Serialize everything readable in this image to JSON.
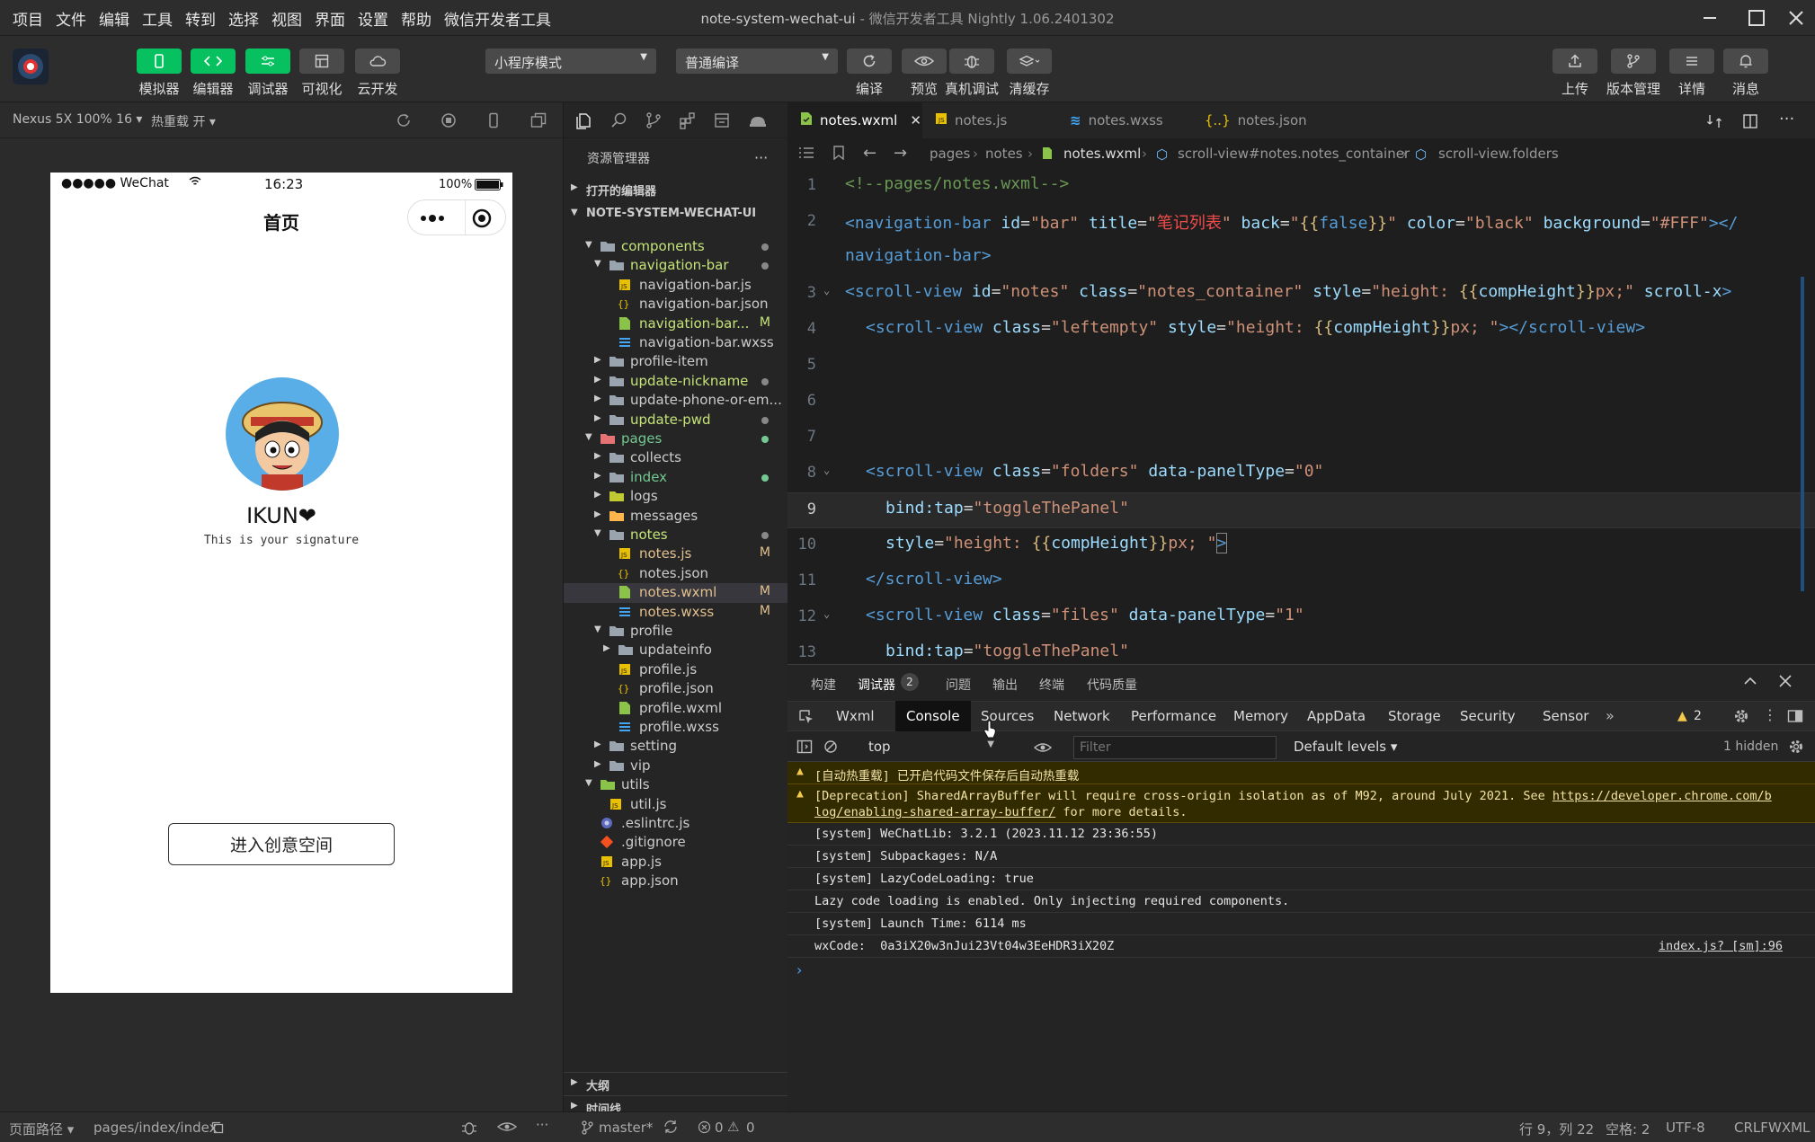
{
  "menu": [
    "项目",
    "文件",
    "编辑",
    "工具",
    "转到",
    "选择",
    "视图",
    "界面",
    "设置",
    "帮助",
    "微信开发者工具"
  ],
  "window_title": "note-system-wechat-ui",
  "app_title": " - 微信开发者工具 Nightly 1.06.2401302",
  "toolbar": {
    "simulator": "模拟器",
    "editor": "编辑器",
    "debugger": "调试器",
    "visualize": "可视化",
    "cloud": "云开发",
    "mode": "小程序模式",
    "compile_mode": "普通编译",
    "compile": "编译",
    "preview": "预览",
    "real_debug": "真机调试",
    "clear_cache": "清缓存",
    "upload": "上传",
    "version": "版本管理",
    "details": "详情",
    "messages": "消息"
  },
  "sim": {
    "device": "Nexus 5X 100% 16 ▾",
    "hotreload": "热重载 开 ▾",
    "carrier": "●●●●● WeChat",
    "time": "16:23",
    "battery": "100%",
    "nav_title": "首页",
    "nickname": "IKUN❤",
    "signature": "This is your signature",
    "enter_button": "进入创意空间"
  },
  "explorer": {
    "title": "资源管理器",
    "open_editors": "打开的编辑器",
    "project": "NOTE-SYSTEM-WECHAT-UI",
    "rows": [
      {
        "name": "components",
        "depth": 1,
        "type": "folder",
        "open": true,
        "color": "#c5e478",
        "dot": "#888"
      },
      {
        "name": "navigation-bar",
        "depth": 2,
        "type": "folder",
        "open": true,
        "color": "#c5e478",
        "dot": "#888"
      },
      {
        "name": "navigation-bar.js",
        "depth": 3,
        "type": "js",
        "color": "#ccc"
      },
      {
        "name": "navigation-bar.json",
        "depth": 3,
        "type": "json",
        "color": "#ccc"
      },
      {
        "name": "navigation-bar...",
        "depth": 3,
        "type": "wxml",
        "color": "#c5e478",
        "mark": "M"
      },
      {
        "name": "navigation-bar.wxss",
        "depth": 3,
        "type": "wxss",
        "color": "#ccc"
      },
      {
        "name": "profile-item",
        "depth": 2,
        "type": "folder",
        "open": false,
        "color": "#ccc"
      },
      {
        "name": "update-nickname",
        "depth": 2,
        "type": "folder",
        "open": false,
        "color": "#c5e478",
        "dot": "#888"
      },
      {
        "name": "update-phone-or-em...",
        "depth": 2,
        "type": "folder",
        "open": false,
        "color": "#ccc"
      },
      {
        "name": "update-pwd",
        "depth": 2,
        "type": "folder",
        "open": false,
        "color": "#c5e478",
        "dot": "#888"
      },
      {
        "name": "pages",
        "depth": 1,
        "type": "folder-red",
        "open": true,
        "color": "#73c991",
        "dot": "#73c991"
      },
      {
        "name": "collects",
        "depth": 2,
        "type": "folder",
        "open": false,
        "color": "#ccc"
      },
      {
        "name": "index",
        "depth": 2,
        "type": "folder",
        "open": false,
        "color": "#73c991",
        "dot": "#73c991"
      },
      {
        "name": "logs",
        "depth": 2,
        "type": "folder-logs",
        "open": false,
        "color": "#ccc"
      },
      {
        "name": "messages",
        "depth": 2,
        "type": "folder-msg",
        "open": false,
        "color": "#ccc"
      },
      {
        "name": "notes",
        "depth": 2,
        "type": "folder",
        "open": true,
        "color": "#c5e478",
        "dot": "#888"
      },
      {
        "name": "notes.js",
        "depth": 3,
        "type": "js",
        "color": "#e2c08d",
        "mark": "M"
      },
      {
        "name": "notes.json",
        "depth": 3,
        "type": "json",
        "color": "#ccc"
      },
      {
        "name": "notes.wxml",
        "depth": 3,
        "type": "wxml",
        "color": "#e2c08d",
        "mark": "M",
        "selected": true
      },
      {
        "name": "notes.wxss",
        "depth": 3,
        "type": "wxss",
        "color": "#e2c08d",
        "mark": "M"
      },
      {
        "name": "profile",
        "depth": 2,
        "type": "folder",
        "open": true,
        "color": "#ccc"
      },
      {
        "name": "updateinfo",
        "depth": 3,
        "type": "folder",
        "open": false,
        "color": "#ccc"
      },
      {
        "name": "profile.js",
        "depth": 3,
        "type": "js",
        "color": "#ccc"
      },
      {
        "name": "profile.json",
        "depth": 3,
        "type": "json",
        "color": "#ccc"
      },
      {
        "name": "profile.wxml",
        "depth": 3,
        "type": "wxml",
        "color": "#ccc"
      },
      {
        "name": "profile.wxss",
        "depth": 3,
        "type": "wxss",
        "color": "#ccc"
      },
      {
        "name": "setting",
        "depth": 2,
        "type": "folder",
        "open": false,
        "color": "#ccc"
      },
      {
        "name": "vip",
        "depth": 2,
        "type": "folder",
        "open": false,
        "color": "#ccc"
      },
      {
        "name": "utils",
        "depth": 1,
        "type": "folder-green",
        "open": true,
        "color": "#ccc"
      },
      {
        "name": "util.js",
        "depth": 2,
        "type": "js",
        "color": "#ccc"
      },
      {
        "name": ".eslintrc.js",
        "depth": 1,
        "type": "eslint",
        "color": "#ccc"
      },
      {
        "name": ".gitignore",
        "depth": 1,
        "type": "git",
        "color": "#ccc"
      },
      {
        "name": "app.js",
        "depth": 1,
        "type": "js",
        "color": "#ccc"
      },
      {
        "name": "app.json",
        "depth": 1,
        "type": "json",
        "color": "#ccc"
      }
    ],
    "outline": "大纲",
    "timeline": "时间线"
  },
  "editor": {
    "tabs": [
      {
        "name": "notes.wxml",
        "type": "wxml",
        "active": true
      },
      {
        "name": "notes.js",
        "type": "js"
      },
      {
        "name": "notes.wxss",
        "type": "wxss"
      },
      {
        "name": "notes.json",
        "type": "json"
      }
    ],
    "crumb": [
      "pages",
      "notes",
      "notes.wxml",
      "scroll-view#notes.notes_container",
      "scroll-view.folders"
    ],
    "line_numbers": [
      "1",
      "2",
      "",
      "3",
      "4",
      "5",
      "6",
      "7",
      "8",
      "9",
      "10",
      "11",
      "12",
      "13"
    ]
  },
  "devtools": {
    "top_tabs": [
      "构建",
      "调试器",
      "问题",
      "输出",
      "终端",
      "代码质量"
    ],
    "debugger_badge": "2",
    "panel_tabs": [
      "Wxml",
      "Console",
      "Sources",
      "Network",
      "Performance",
      "Memory",
      "AppData",
      "Storage",
      "Security",
      "Sensor"
    ],
    "warn_count": "2",
    "context": "top",
    "filter_placeholder": "Filter",
    "levels": "Default levels ▾",
    "hidden": "1 hidden",
    "logs": [
      {
        "type": "warn",
        "text": "[自动热重载] 已开启代码文件保存后自动热重载"
      },
      {
        "type": "warn",
        "text": "[Deprecation] SharedArrayBuffer will require cross-origin isolation as of M92, around July 2021. See ",
        "link1": "https://developer.chrome.com/b",
        "link2": "log/enabling-shared-array-buffer/",
        "tail": " for more details."
      },
      {
        "type": "log",
        "text": "[system] WeChatLib: 3.2.1 (2023.11.12 23:36:55)"
      },
      {
        "type": "log",
        "text": "[system] Subpackages: N/A"
      },
      {
        "type": "log",
        "text": "[system] LazyCodeLoading: true"
      },
      {
        "type": "log",
        "text": "Lazy code loading is enabled. Only injecting required components."
      },
      {
        "type": "log",
        "text": "[system] Launch Time: 6114 ms"
      },
      {
        "type": "log",
        "text": "wxCode:  0a3iX20w3nJui23Vt04w3EeHDR3iX20Z",
        "source": "index.js? [sm]:96"
      }
    ]
  },
  "status": {
    "page_path_label": "页面路径 ▾",
    "page_path": "pages/index/index",
    "branch": "master*",
    "errors": "0",
    "warnings": "0",
    "cursor": "行 9，列 22",
    "spaces": "空格: 2",
    "encoding": "UTF-8",
    "eol": "CRLF",
    "lang": "WXML"
  },
  "colors": {
    "accent": "#07c160",
    "selection": "#37373d",
    "editor_bg": "#1e1e1e"
  }
}
